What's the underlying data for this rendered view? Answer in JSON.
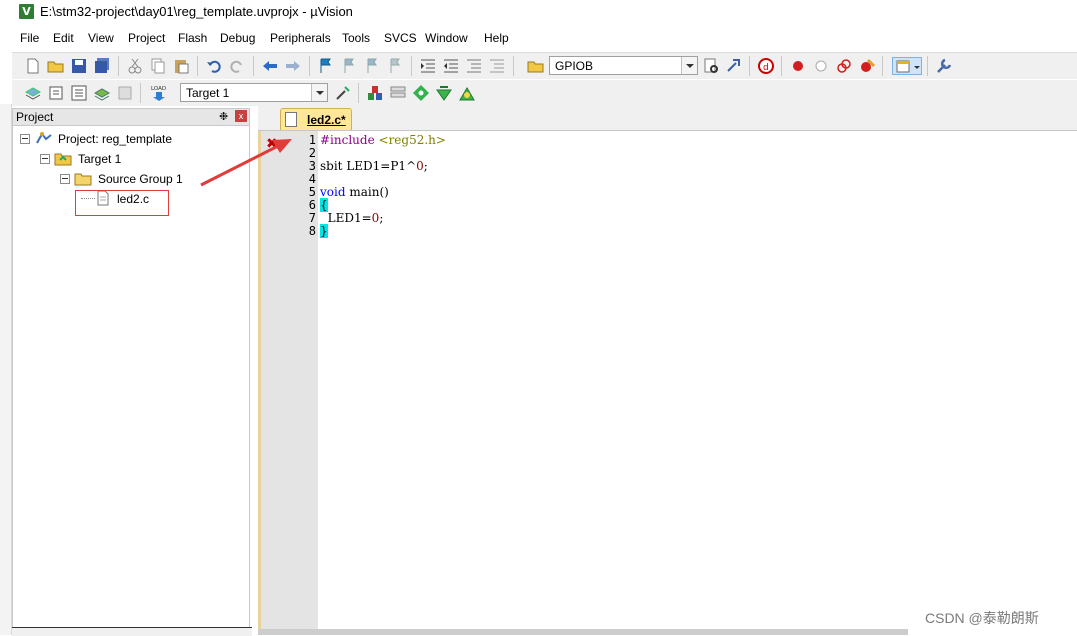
{
  "window": {
    "title": "E:\\stm32-project\\day01\\reg_template.uvprojx - µVision",
    "app_icon": "V"
  },
  "menu": [
    "File",
    "Edit",
    "View",
    "Project",
    "Flash",
    "Debug",
    "Peripherals",
    "Tools",
    "SVCS",
    "Window",
    "Help"
  ],
  "toolbar1": {
    "target_combo": "GPIOB"
  },
  "toolbar2": {
    "target_select": "Target 1",
    "load_label": "LOAD"
  },
  "project_panel": {
    "title": "Project",
    "pin_glyph": "❉",
    "close_glyph": "x",
    "tree": {
      "project": "Project: reg_template",
      "target": "Target 1",
      "group": "Source Group 1",
      "file": "led2.c"
    }
  },
  "editor": {
    "tab_label": "led2.c*",
    "error_glyph": "✖",
    "line_numbers": [
      "1",
      "2",
      "3",
      "4",
      "5",
      "6",
      "7",
      "8"
    ],
    "lines": {
      "l1_directive": "#include ",
      "l1_header": "<reg52.h>",
      "l3_pre": "sbit LED1=P1",
      "l3_caret": "^",
      "l3_num": "0",
      "l3_end": ";",
      "l5_kw": "void",
      "l5_rest": " main()",
      "l6": "{",
      "l7_pre": "  LED1=",
      "l7_num": "0",
      "l7_end": ";",
      "l8": "}"
    }
  },
  "watermark": "CSDN @泰勒朗斯",
  "colors": {
    "keyword": "#0000ff",
    "directive": "#8b008b",
    "header": "#808000",
    "brace_highlight": "#00e5e5",
    "annotation": "#e23b3b"
  }
}
